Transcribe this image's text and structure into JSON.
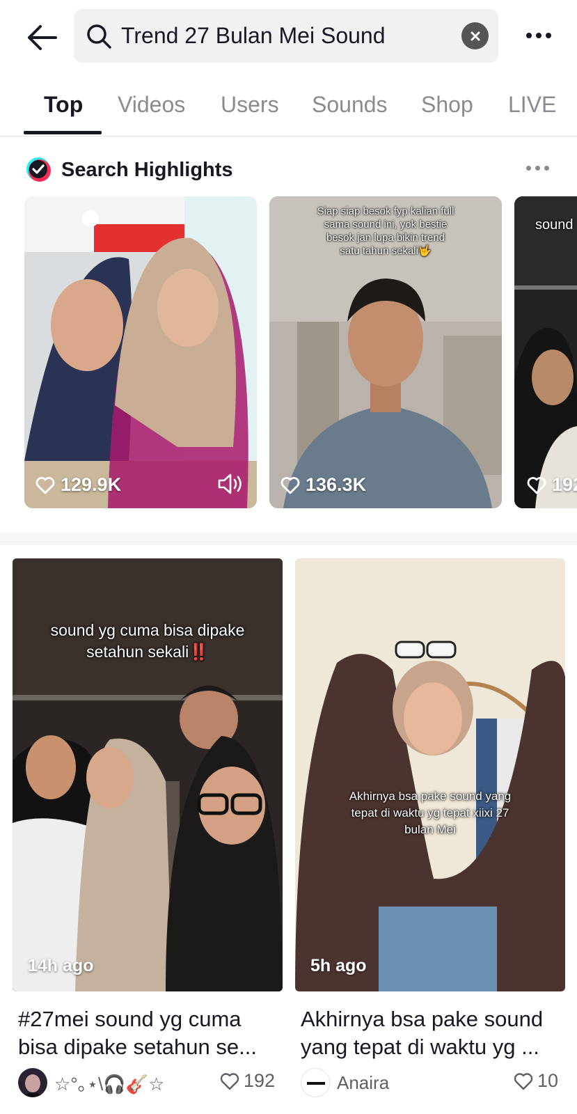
{
  "search": {
    "query": "Trend 27 Bulan Mei Sound"
  },
  "tabs": [
    {
      "label": "Top",
      "active": true
    },
    {
      "label": "Videos"
    },
    {
      "label": "Users"
    },
    {
      "label": "Sounds"
    },
    {
      "label": "Shop"
    },
    {
      "label": "LIVE"
    }
  ],
  "highlights": {
    "title": "Search Highlights",
    "cards": [
      {
        "likes": "129.9K",
        "caption": ""
      },
      {
        "likes": "136.3K",
        "caption": "Siap siap besok fyp kalian full sama sound ini, yok bestie besok jan lupa bikin trend satu tahun sekali🤟"
      },
      {
        "likes": "192",
        "caption": "sound"
      }
    ]
  },
  "videos": [
    {
      "caption": "sound yg cuma bisa dipake setahun sekali‼️",
      "time": "14h ago",
      "title": "#27mei sound yg cuma bisa dipake setahun se...",
      "author": "☆°｡⋆\\🎧🎸☆",
      "likes": "192"
    },
    {
      "caption": "Akhirnya bsa pake sound yang tepat di waktu yg tepat xiixi 27 bulan Mei",
      "time": "5h ago",
      "title": "Akhirnya bsa pake sound yang tepat di waktu yg ...",
      "author": "Anaira",
      "likes": "10"
    }
  ],
  "colors": {
    "text": "#161823",
    "muted": "#8a8b91",
    "divider": "#f5f5f6"
  }
}
